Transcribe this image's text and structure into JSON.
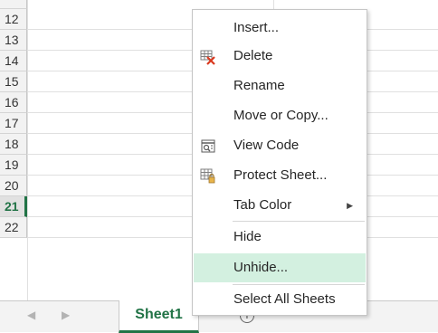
{
  "rows": [
    {
      "num": "12",
      "active": false
    },
    {
      "num": "13",
      "active": false
    },
    {
      "num": "14",
      "active": false
    },
    {
      "num": "15",
      "active": false
    },
    {
      "num": "16",
      "active": false
    },
    {
      "num": "17",
      "active": false
    },
    {
      "num": "18",
      "active": false
    },
    {
      "num": "19",
      "active": false
    },
    {
      "num": "20",
      "active": false
    },
    {
      "num": "21",
      "active": true
    },
    {
      "num": "22",
      "active": false
    }
  ],
  "context_menu": {
    "items": [
      {
        "label": "Insert...",
        "icon": "",
        "hover": false
      },
      {
        "label": "Delete",
        "icon": "delete-sheet-icon",
        "hover": false
      },
      {
        "label": "Rename",
        "icon": "",
        "hover": false
      },
      {
        "label": "Move or Copy...",
        "icon": "",
        "hover": false
      },
      {
        "label": "View Code",
        "icon": "view-code-icon",
        "hover": false
      },
      {
        "label": "Protect Sheet...",
        "icon": "protect-sheet-icon",
        "hover": false
      },
      {
        "label": "Tab Color",
        "icon": "",
        "hover": false,
        "submenu": true
      },
      {
        "label": "Hide",
        "icon": "",
        "hover": false
      },
      {
        "label": "Unhide...",
        "icon": "",
        "hover": true
      },
      {
        "label": "Select All Sheets",
        "icon": "",
        "hover": false
      }
    ]
  },
  "tabs": {
    "sheet_name": "Sheet1",
    "add_label": "+",
    "nav_prev": "◀",
    "nav_next": "▶"
  },
  "colors": {
    "accent": "#217346",
    "hover": "#d3f0e0",
    "delete_icon": "#d9381e"
  }
}
